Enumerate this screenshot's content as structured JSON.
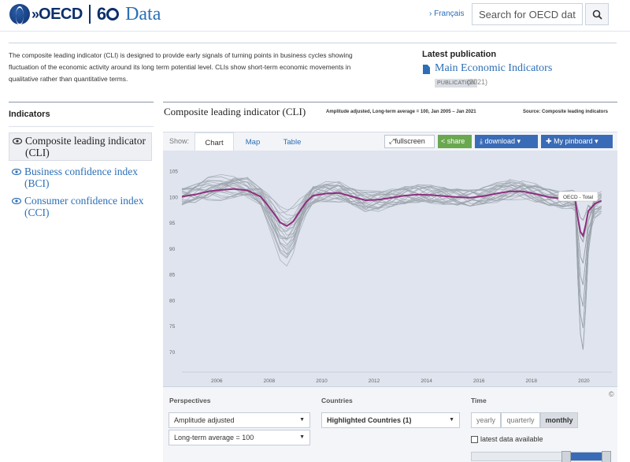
{
  "header": {
    "logo_text": "OECD",
    "logo_anniversary": "60",
    "brand": "Data",
    "lang_link": "› Français",
    "search_placeholder": "Search for OECD data"
  },
  "intro": {
    "text": "The composite leading indicator (CLI) is designed to provide early signals of turning points in business cycles showing fluctuation of the economic activity around its long term potential level. CLIs show short-term economic movements in qualitative rather than quantitative terms."
  },
  "latest_publication": {
    "heading": "Latest publication",
    "title": "Main Economic Indicators",
    "badge": "PUBLICATION",
    "year": "(2021)"
  },
  "indicators": {
    "heading": "Indicators",
    "items": [
      {
        "label": "Composite leading indicator (CLI)",
        "active": true
      },
      {
        "label": "Business confidence index (BCI)",
        "active": false
      },
      {
        "label": "Consumer confidence index (CCI)",
        "active": false
      }
    ]
  },
  "chart_header": {
    "title": "Composite leading indicator (CLI)",
    "subtitle": "Amplitude adjusted, Long-term average = 100, Jan 2005 – Jan 2021",
    "source": "Source: Composite leading indicators"
  },
  "toolbar": {
    "show_label": "Show:",
    "tabs": [
      "Chart",
      "Map",
      "Table"
    ],
    "active_tab": "Chart",
    "fullscreen": "fullscreen",
    "share": "share",
    "download": "download",
    "pinboard": "My pinboard"
  },
  "controls": {
    "perspectives_label": "Perspectives",
    "perspective_1": "Amplitude adjusted",
    "perspective_2": "Long-term average = 100",
    "countries_label": "Countries",
    "countries_value": "Highlighted Countries (1)",
    "time_label": "Time",
    "time_options": [
      "yearly",
      "quarterly",
      "monthly"
    ],
    "time_selected": "monthly",
    "latest_checkbox": "latest data available",
    "copyright": "©"
  },
  "colors": {
    "highlight": "#8e2f7e",
    "background_lines": "#9aa1aa",
    "plot_bg": "#dfe4ee",
    "accent_blue": "#3a6bb6",
    "share_green": "#6aa84f"
  },
  "chart_data": {
    "type": "line",
    "x": [
      2005.0,
      2005.5,
      2006.0,
      2006.5,
      2007.0,
      2007.5,
      2008.0,
      2008.25,
      2008.5,
      2008.75,
      2009.0,
      2009.25,
      2009.5,
      2009.75,
      2010.0,
      2010.5,
      2011.0,
      2011.5,
      2012.0,
      2012.5,
      2013.0,
      2013.5,
      2014.0,
      2014.5,
      2015.0,
      2015.5,
      2016.0,
      2016.5,
      2017.0,
      2017.5,
      2018.0,
      2018.5,
      2019.0,
      2019.5,
      2019.9,
      2020.0,
      2020.1,
      2020.2,
      2020.3,
      2020.4,
      2020.5,
      2020.75,
      2021.0
    ],
    "series": [
      {
        "name": "OECD - Total",
        "highlighted": true,
        "values": [
          100.0,
          100.4,
          101.0,
          101.3,
          101.5,
          101.2,
          100.0,
          98.5,
          96.8,
          95.0,
          94.3,
          95.2,
          97.2,
          99.0,
          100.2,
          100.6,
          100.7,
          100.0,
          99.3,
          99.4,
          99.8,
          100.2,
          100.4,
          100.3,
          100.1,
          99.9,
          99.8,
          100.1,
          100.6,
          101.0,
          101.0,
          100.5,
          99.9,
          99.6,
          99.6,
          99.3,
          96.0,
          93.2,
          92.4,
          94.5,
          97.2,
          98.6,
          99.2
        ]
      }
    ],
    "label": "OECD - Total",
    "xlim": [
      2005,
      2021.1
    ],
    "ylim": [
      66,
      108
    ],
    "y_ticks": [
      70,
      75,
      80,
      85,
      90,
      95,
      100,
      105
    ],
    "x_ticks": [
      2006,
      2008,
      2010,
      2012,
      2014,
      2016,
      2018,
      2020
    ],
    "grid": false
  }
}
